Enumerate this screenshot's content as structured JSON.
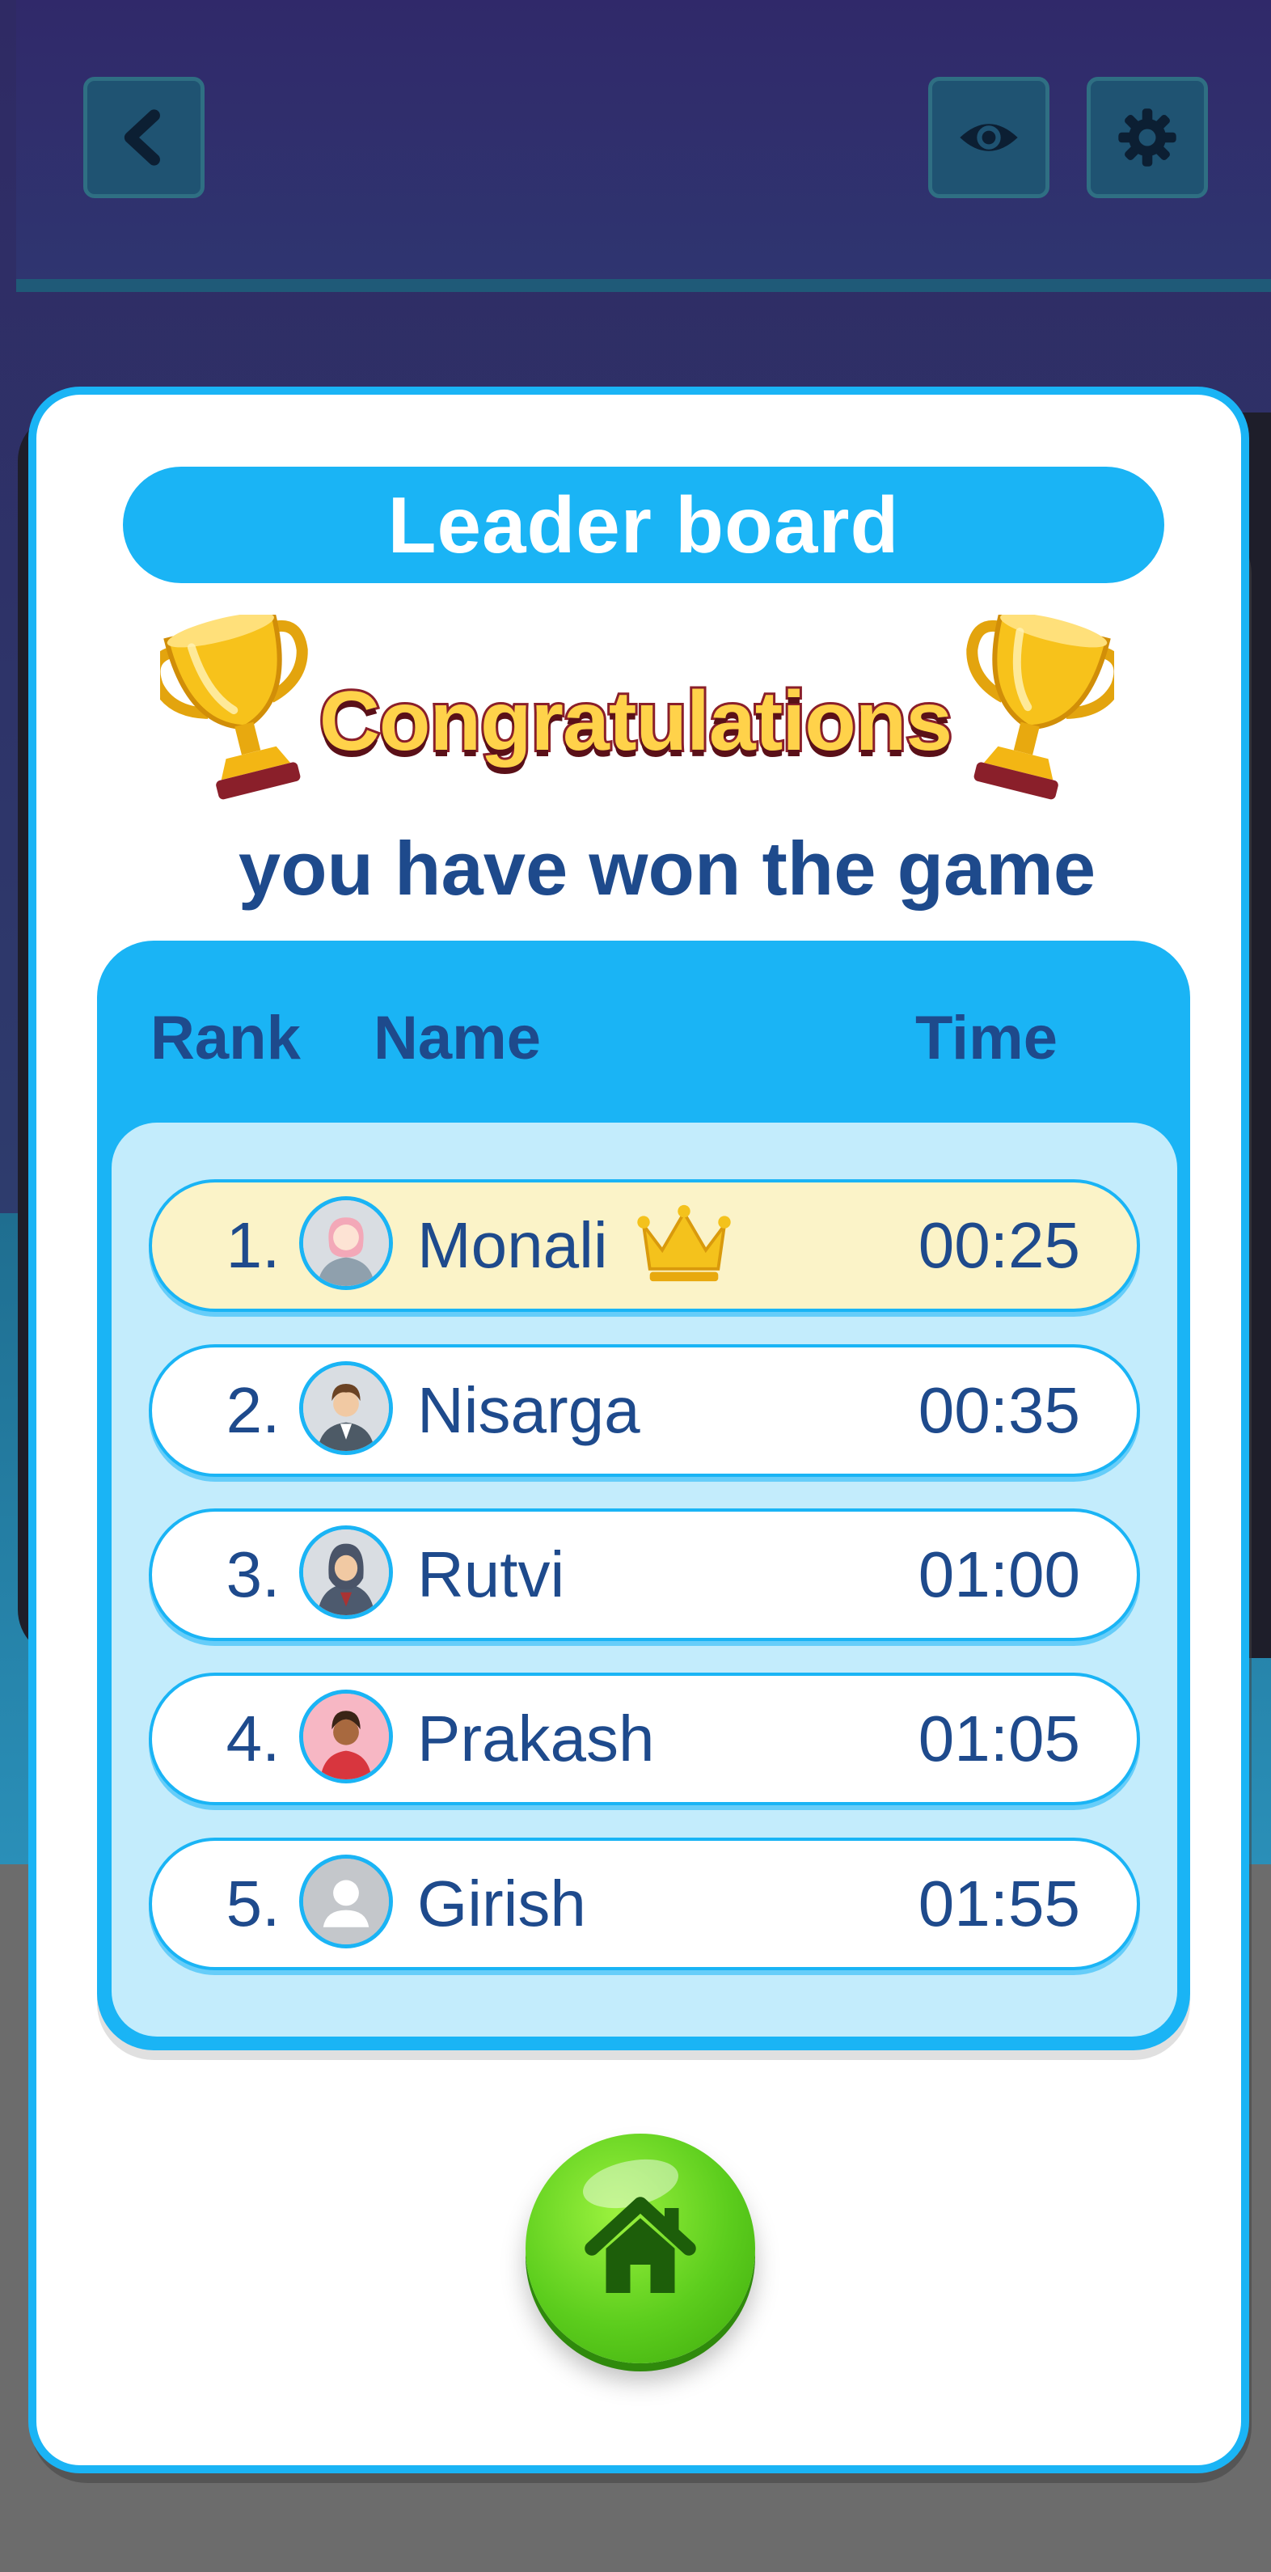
{
  "modal": {
    "title": "Leader board",
    "congrats": "Congratulations",
    "subtitle": "you have won the game"
  },
  "table": {
    "headers": {
      "rank": "Rank",
      "name": "Name",
      "time": "Time"
    },
    "rows": [
      {
        "rank": "1.",
        "name": "Monali",
        "time": "00:25",
        "avatar": "woman-avatar-icon",
        "crown": true
      },
      {
        "rank": "2.",
        "name": "Nisarga",
        "time": "00:35",
        "avatar": "businessman-avatar-icon"
      },
      {
        "rank": "3.",
        "name": "Rutvi",
        "time": "01:00",
        "avatar": "hijab-woman-avatar-icon"
      },
      {
        "rank": "4.",
        "name": "Prakash",
        "time": "01:05",
        "avatar": "man-avatar-icon"
      },
      {
        "rank": "5.",
        "name": "Girish",
        "time": "01:55",
        "avatar": "default-user-icon"
      }
    ]
  },
  "header": {
    "icons": [
      "back-icon",
      "eye-icon",
      "gear-icon"
    ]
  },
  "colors": {
    "accent": "#1ab4f5",
    "text": "#1e4a8c",
    "highlight_row": "#fbf3c8",
    "home_button": "#5ccd1d",
    "background": "#2f2a64"
  }
}
